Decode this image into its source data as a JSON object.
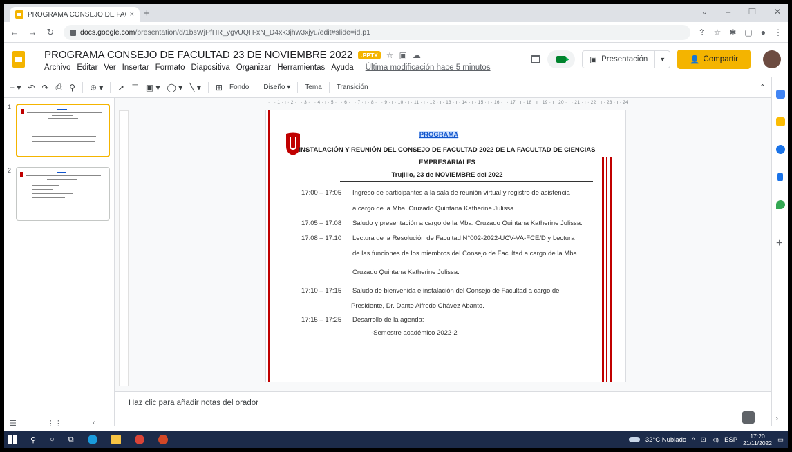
{
  "browser": {
    "tab_title": "PROGRAMA CONSEJO DE FACUL",
    "tab_close": "×",
    "new_tab": "+",
    "url_domain": "docs.google.com",
    "url_path": "/presentation/d/1bsWjPfHR_ygvUQH-xN_D4xk3jhw3xjyu/edit#slide=id.p1"
  },
  "app": {
    "doc_title": "PROGRAMA CONSEJO DE FACULTAD 23 DE NOVIEMBRE 2022",
    "file_badge": ".PPTX",
    "menu": [
      "Archivo",
      "Editar",
      "Ver",
      "Insertar",
      "Formato",
      "Diapositiva",
      "Organizar",
      "Herramientas",
      "Ayuda"
    ],
    "last_edit": "Última modificación hace 5 minutos",
    "present_label": "Presentación",
    "share_label": "Compartir"
  },
  "toolbar": {
    "background": "Fondo",
    "layout": "Diseño ▾",
    "theme": "Tema",
    "transition": "Transición"
  },
  "ruler": {
    "ticks": "· ı · 1 · ı · 2 · ı · 3 · ı · 4 · ı · 5 · ı · 6 · ı · 7 · ı · 8 · ı · 9 · ı · 10 · ı · 11 · ı · 12 · ı · 13 · ı · 14 · ı · 15 · ı · 16 · ı · 17 · ı · 18 · ı · 19 · ı · 20 · ı · 21 · ı · 22 · ı · 23 · ı · 24 · ı · 25 ·"
  },
  "filmstrip": {
    "slide_numbers": [
      "1",
      "2"
    ]
  },
  "slide": {
    "program": "PROGRAMA",
    "title_line1": "INSTALACIÓN  Y REUNIÓN DEL CONSEJO DE FACULTAD 2022 DE LA FACULTAD DE CIENCIAS",
    "title_line2": "EMPRESARIALES",
    "date_line": "Trujillo, 23 de NOVIEMBRE del 2022",
    "agenda": [
      {
        "time": "17:00 – 17:05",
        "line1": "Ingreso de participantes a la sala de reunión virtual y registro de asistencia",
        "line2": "a cargo de la Mba. Cruzado Quintana Katherine Julissa."
      },
      {
        "time": "17:05 – 17:08",
        "line1": "Saludo y presentación a cargo de la Mba. Cruzado Quintana Katherine Julissa."
      },
      {
        "time": "17:08 – 17:10",
        "line1": "Lectura de la Resolución de Facultad N°002-2022-UCV-VA-FCE/D y Lectura",
        "line2": "de las funciones de los miembros del Consejo de Facultad a cargo de la Mba.",
        "line3": "Cruzado Quintana Katherine Julissa."
      },
      {
        "time": "17:10 – 17:15",
        "line1": "Saludo de bienvenida e instalación del Consejo de Facultad a cargo del",
        "line2": "Presidente, Dr. Dante Alfredo Chávez Abanto."
      },
      {
        "time": "17:15 – 17:25",
        "line1": "Desarrollo de la agenda:",
        "line2": "-Semestre académico 2022-2"
      }
    ]
  },
  "notes": {
    "placeholder": "Haz clic para añadir notas del orador"
  },
  "taskbar": {
    "weather": "32°C  Nublado",
    "lang": "ESP",
    "time": "17:20",
    "date": "21/11/2022"
  },
  "colors": {
    "accent": "#f4b400",
    "slide_red": "#c00000"
  }
}
